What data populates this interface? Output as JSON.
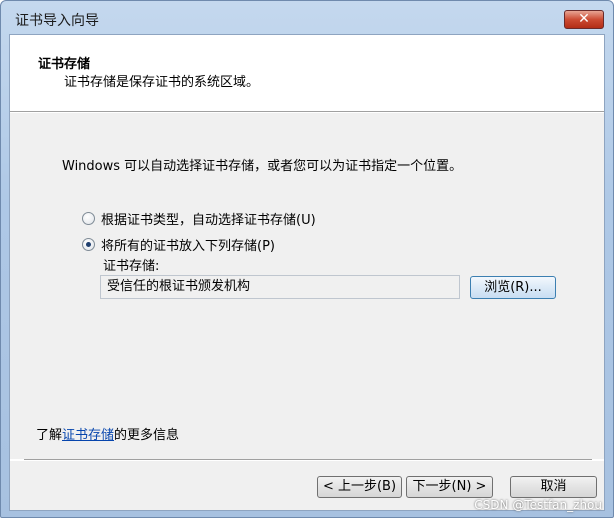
{
  "window": {
    "title": "证书导入向导",
    "close_glyph": "✕"
  },
  "header": {
    "title": "证书存储",
    "description": "证书存储是保存证书的系统区域。"
  },
  "body": {
    "intro": "Windows 可以自动选择证书存储，或者您可以为证书指定一个位置。",
    "options": [
      {
        "label": "根据证书类型，自动选择证书存储(U)",
        "checked": false
      },
      {
        "label": "将所有的证书放入下列存储(P)",
        "checked": true
      }
    ],
    "store_label": "证书存储:",
    "store_value": "受信任的根证书颁发机构",
    "browse_label": "浏览(R)...",
    "more_info_prefix": "了解",
    "more_info_link": "证书存储",
    "more_info_suffix": "的更多信息"
  },
  "footer": {
    "back_label": "< 上一步(B)",
    "next_label": "下一步(N) >",
    "cancel_label": "取消"
  },
  "watermark": "CSDN @Testfan_zhou"
}
